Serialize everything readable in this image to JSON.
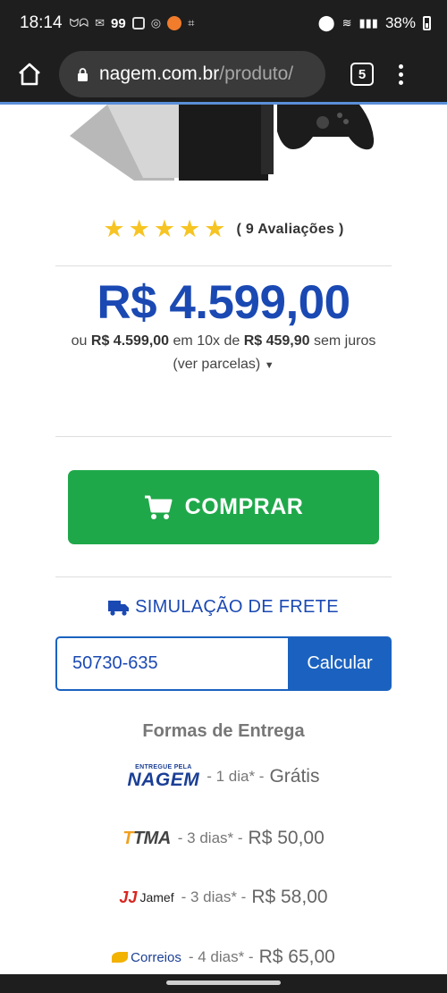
{
  "status_bar": {
    "time": "18:14",
    "notif_text": "99",
    "battery": "38%"
  },
  "browser": {
    "url_domain": "nagem.com.br",
    "url_path": "/produto/",
    "tab_count": "5"
  },
  "product": {
    "reviews_label": "( 9 Avaliações )",
    "stars": 5,
    "price": "R$ 4.599,00",
    "installments": {
      "prefix": "ou",
      "total": "R$ 4.599,00",
      "middle": "em 10x de",
      "parcel": "R$ 459,90",
      "suffix": "sem juros"
    },
    "ver_parcelas": "(ver parcelas)"
  },
  "buy_button": {
    "label": "COMPRAR"
  },
  "freight": {
    "title": "SIMULAÇÃO DE FRETE",
    "cep_value": "50730-635",
    "calc_label": "Calcular"
  },
  "delivery": {
    "title": "Formas de Entrega",
    "options": [
      {
        "carrier": "NAGEM",
        "carrier_small": "ENTREGUE PELA",
        "days": "- 1 dia* -",
        "price": "Grátis"
      },
      {
        "carrier": "TMA",
        "days": "- 3 dias* -",
        "price": "R$ 50,00"
      },
      {
        "carrier": "Jamef",
        "days": "- 3 dias* -",
        "price": "R$ 58,00"
      },
      {
        "carrier": "Correios",
        "days": "- 4 dias* -",
        "price": "R$ 65,00"
      }
    ]
  },
  "colors": {
    "accent_blue": "#1b49b3",
    "buy_green": "#1fa84a",
    "star_yellow": "#f6c423"
  }
}
